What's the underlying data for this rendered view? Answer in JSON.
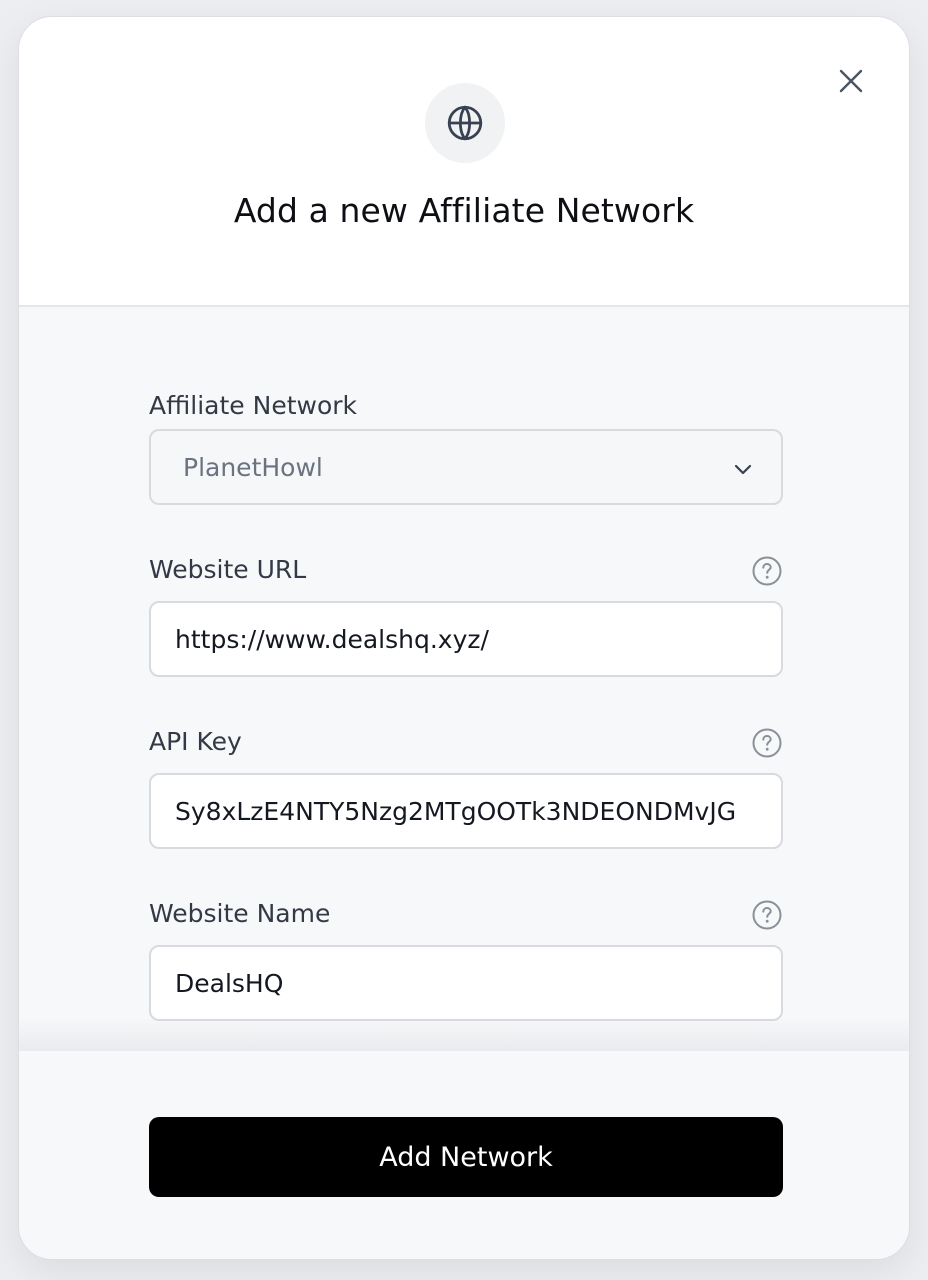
{
  "modal": {
    "title": "Add a new Affiliate Network",
    "header_icon": "globe-icon",
    "close_icon": "close-icon"
  },
  "form": {
    "affiliate_network": {
      "label": "Affiliate Network",
      "selected_value": "PlanetHowl",
      "icon": "chevron-down-icon"
    },
    "website_url": {
      "label": "Website URL",
      "value": "https://www.dealshq.xyz/",
      "help_icon": "question-circle-icon"
    },
    "api_key": {
      "label": "API Key",
      "value": "Sy8xLzE4NTY5Nzg2MTgOOTk3NDEONDMvJG",
      "help_icon": "question-circle-icon"
    },
    "website_name": {
      "label": "Website Name",
      "value": "DealsHQ",
      "help_icon": "question-circle-icon"
    }
  },
  "footer": {
    "submit_label": "Add Network"
  },
  "colors": {
    "primary_button": "#000000",
    "header_bg": "#ffffff",
    "body_bg": "#f7f8fa",
    "input_border": "#d7dade",
    "label_text": "#333a46"
  }
}
